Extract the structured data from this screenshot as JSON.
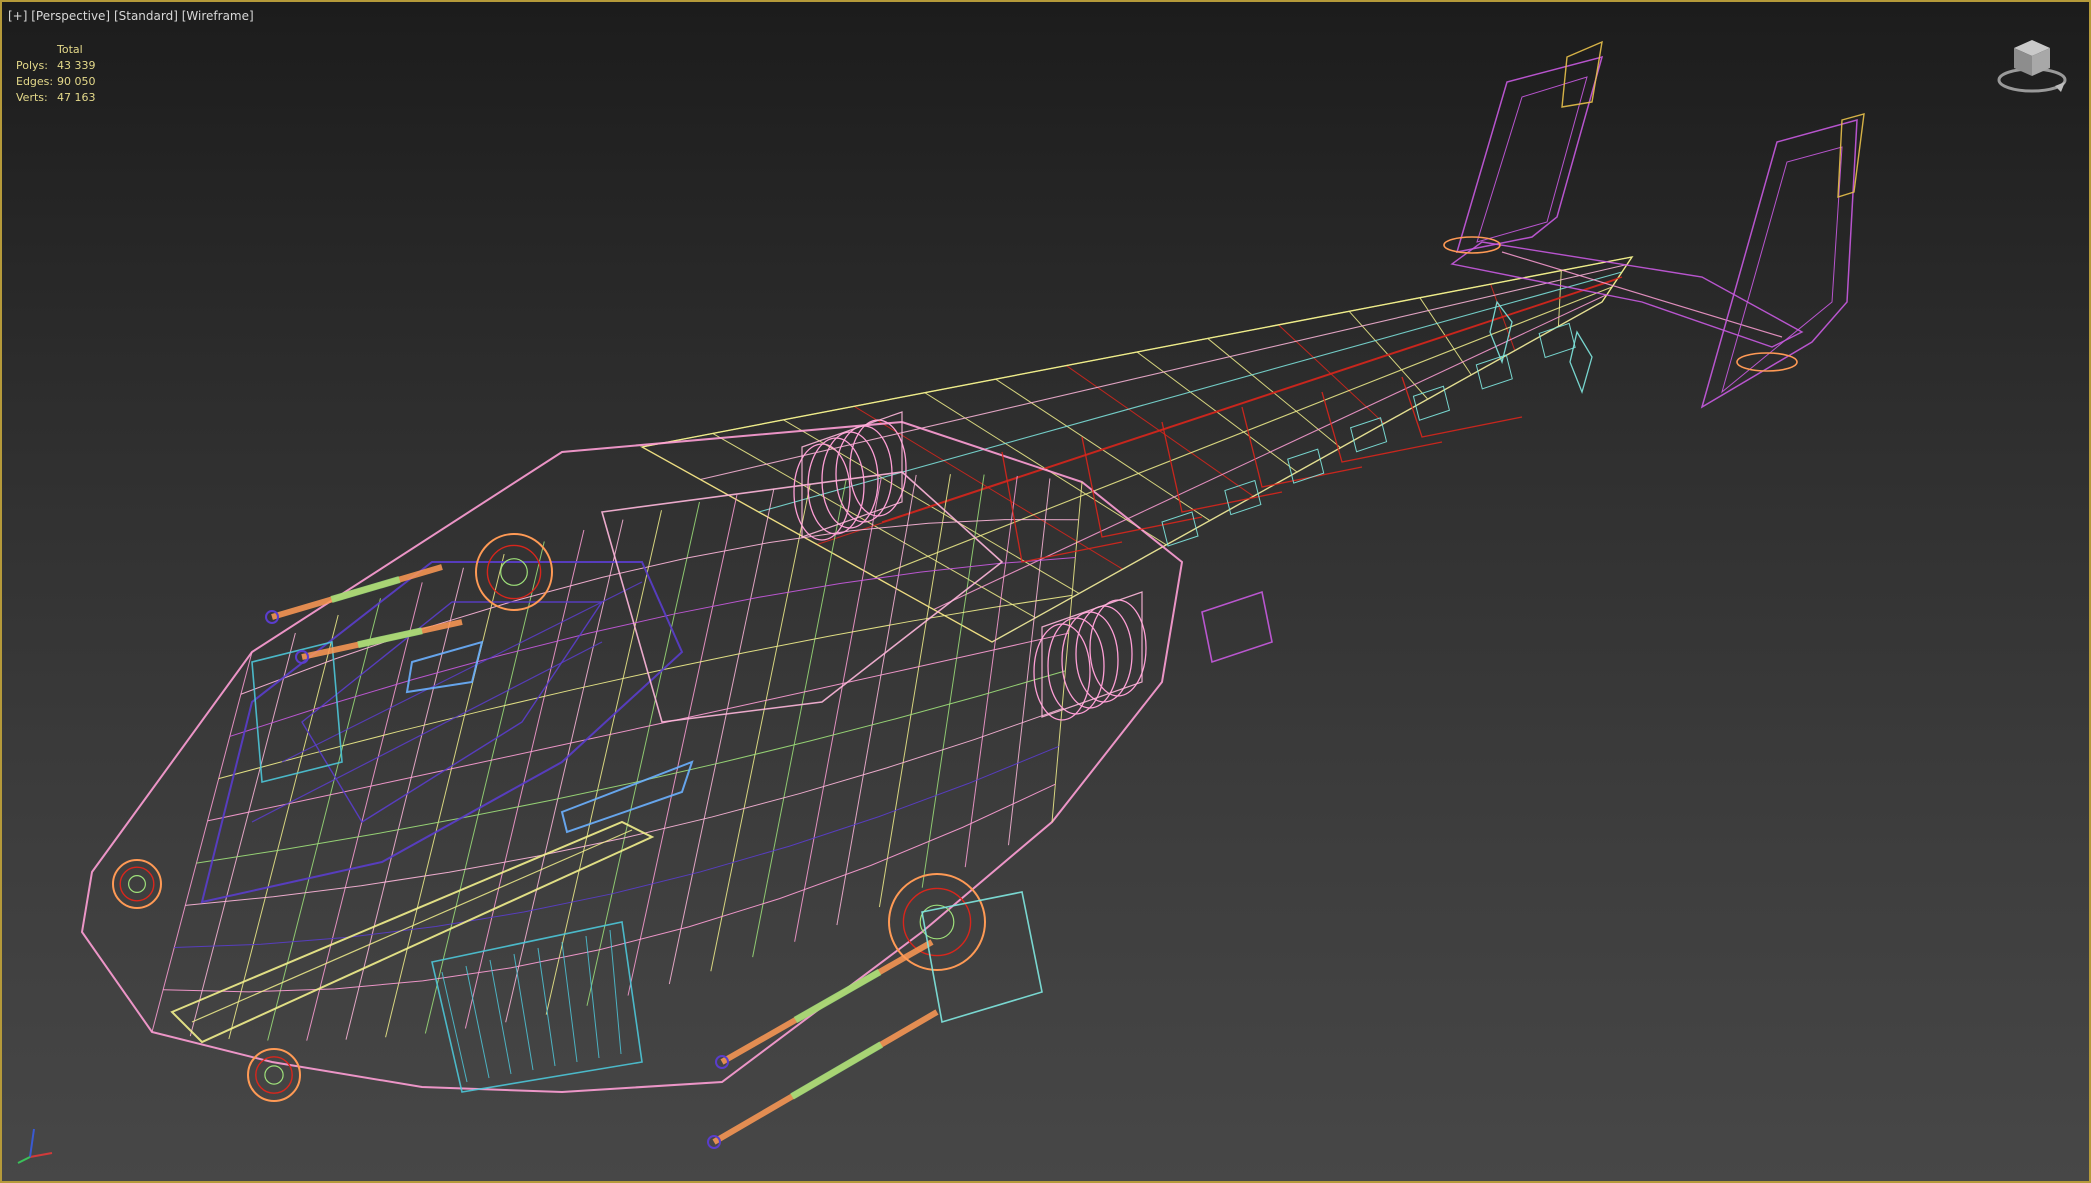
{
  "viewport": {
    "labels": {
      "plus": "[+]",
      "view": "[Perspective]",
      "shading_mode": "[Standard]",
      "render_mode": "[Wireframe]"
    },
    "stats": {
      "header": "Total",
      "polys_label": "Polys:",
      "polys_value": "43 339",
      "edges_label": "Edges:",
      "edges_value": "90 050",
      "verts_label": "Verts:",
      "verts_value": "47 163"
    },
    "border_color": "#b59a3a",
    "wire_colors": [
      "#ff9fd6",
      "#ffb7dc",
      "#f2f08c",
      "#9ee07a",
      "#4dc6d8",
      "#5a3dcc",
      "#d9261c",
      "#c85ae0",
      "#ff9a55",
      "#7fe8e0",
      "#6ab0ff",
      "#e8c14a"
    ]
  },
  "icons": {
    "viewcube": "viewcube-icon",
    "axis": "axis-tripod-icon"
  }
}
